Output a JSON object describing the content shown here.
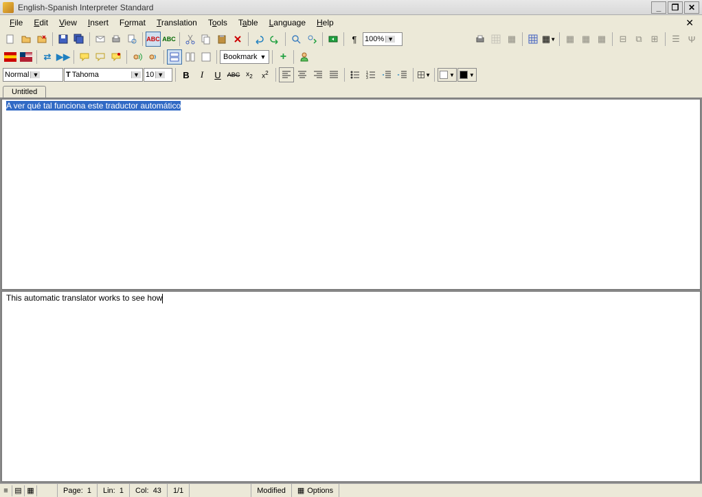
{
  "window": {
    "title": "English-Spanish Interpreter Standard"
  },
  "menu": [
    "File",
    "Edit",
    "View",
    "Insert",
    "Format",
    "Translation",
    "Tools",
    "Table",
    "Language",
    "Help"
  ],
  "style_combo": "Normal",
  "font_combo": "Tahoma",
  "size_combo": "10",
  "zoom": "100%",
  "bookmark_label": "Bookmark",
  "tab_label": "Untitled",
  "source_text": "A ver qué tal funciona este traductor automático",
  "target_text": "This automatic translator works to see how",
  "status": {
    "page": "Page:",
    "page_val": "1",
    "line": "Lin:",
    "line_val": "1",
    "col": "Col:",
    "col_val": "43",
    "pages": "1/1",
    "modified": "Modified",
    "options": "Options"
  },
  "colors": {
    "fontcolor": "#ffffff",
    "highlight": "#000000"
  }
}
